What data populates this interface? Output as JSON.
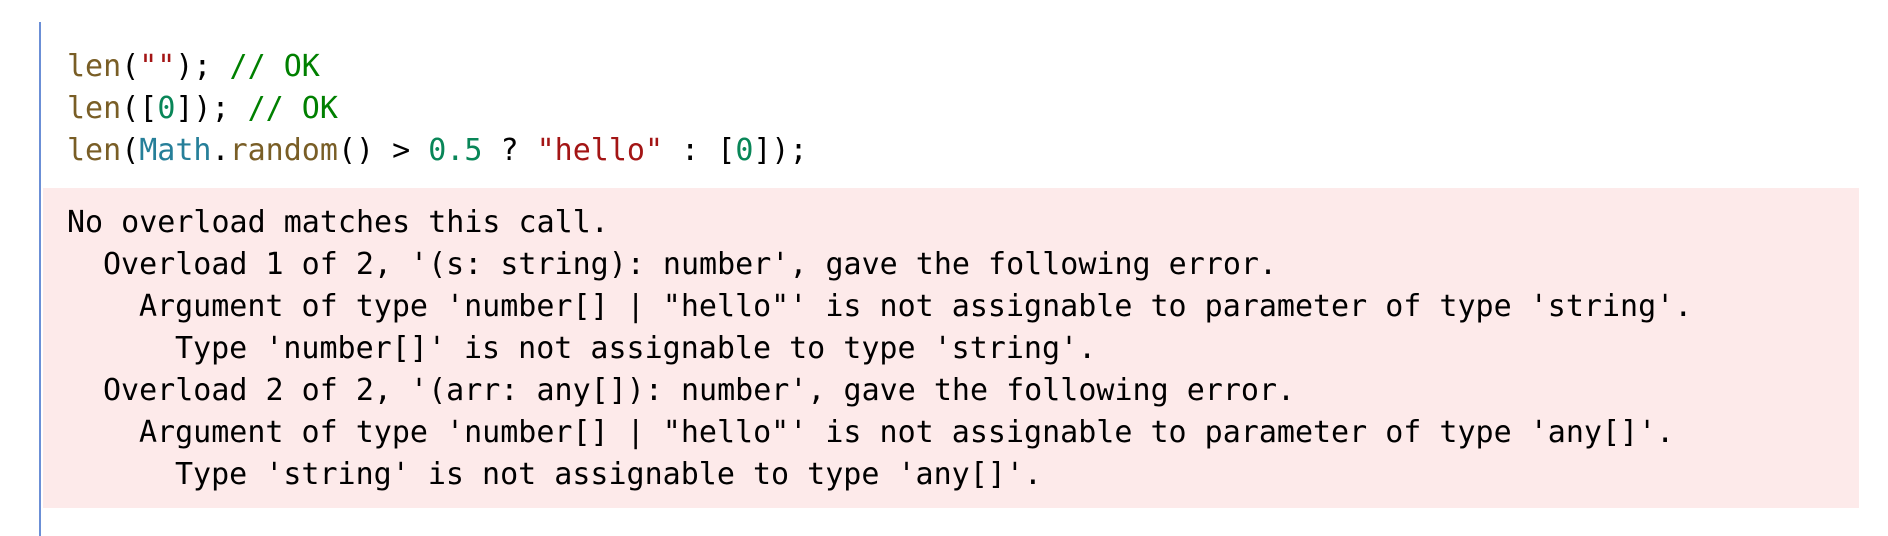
{
  "code": {
    "line1": {
      "fn": "len",
      "open": "(",
      "str": "\"\"",
      "close": ");",
      "comment": " // OK"
    },
    "line2": {
      "fn": "len",
      "open": "([",
      "num": "0",
      "close": "]);",
      "comment": " // OK"
    },
    "line3": {
      "fn": "len",
      "open": "(",
      "obj": "Math",
      "dot": ".",
      "method": "random",
      "call": "() > ",
      "num": "0.5",
      "ternary": " ? ",
      "str": "\"hello\"",
      "colon": " : [",
      "num2": "0",
      "close": "]);"
    }
  },
  "error": {
    "lines": [
      "No overload matches this call.",
      "Overload 1 of 2, '(s: string): number', gave the following error.",
      "Argument of type 'number[] | \"hello\"' is not assignable to parameter of type 'string'.",
      "Type 'number[]' is not assignable to type 'string'.",
      "Overload 2 of 2, '(arr: any[]): number', gave the following error.",
      "Argument of type 'number[] | \"hello\"' is not assignable to parameter of type 'any[]'.",
      "Type 'string' is not assignable to type 'any[]'."
    ]
  },
  "colors": {
    "function": "#795e26",
    "string": "#a31515",
    "number": "#098658",
    "comment": "#008000",
    "type": "#267f99",
    "error_background": "#fdeaea",
    "gutter_border": "#6b8fd6"
  }
}
